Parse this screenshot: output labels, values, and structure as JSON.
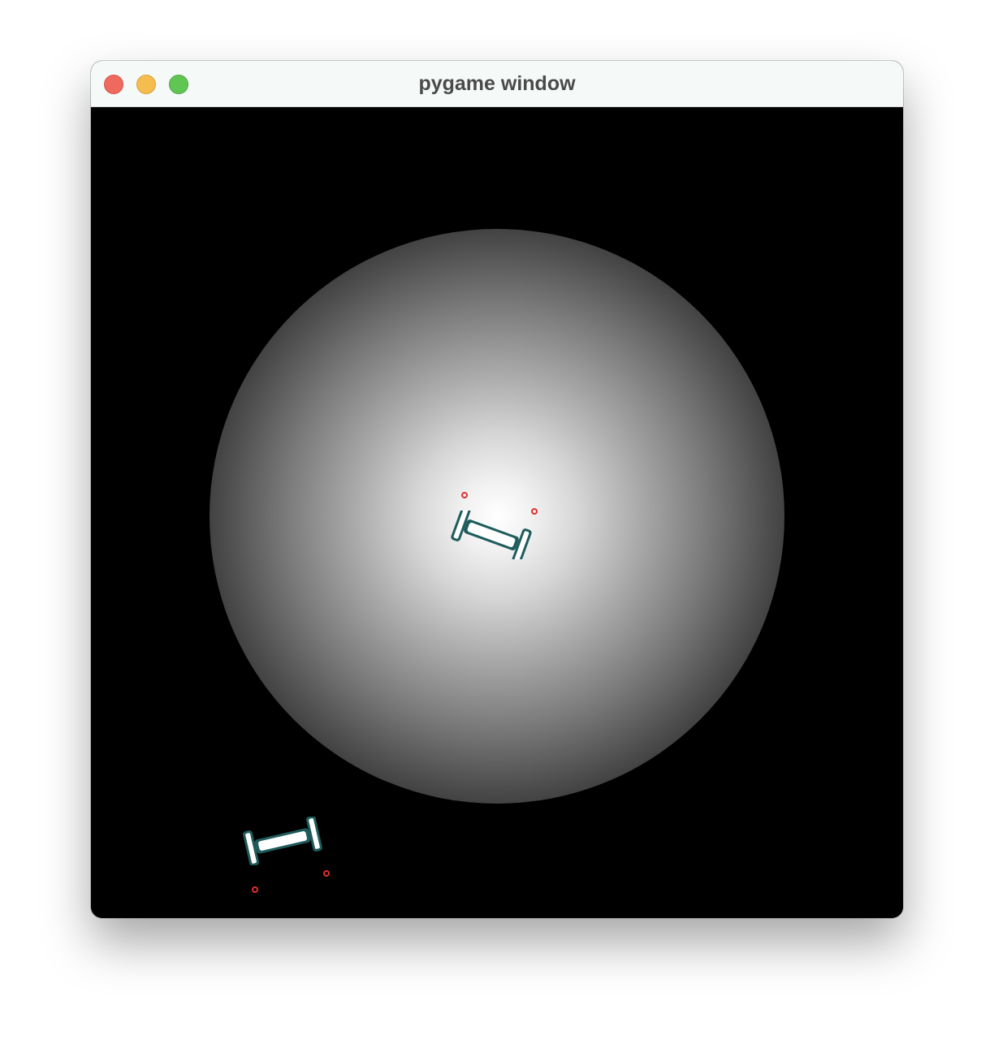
{
  "window": {
    "title": "pygame window"
  },
  "colors": {
    "close": "#ee6a5f",
    "minimize": "#f5bd4f",
    "maximize": "#61c554",
    "robot_outline": "#1f5c5c",
    "robot_body": "#ffffff",
    "sensor": "#e03030",
    "background": "#000000"
  },
  "icons": {
    "close": "close-icon",
    "minimize": "minimize-icon",
    "maximize": "maximize-icon",
    "robot": "robot-icon",
    "sensor": "sensor-icon"
  }
}
